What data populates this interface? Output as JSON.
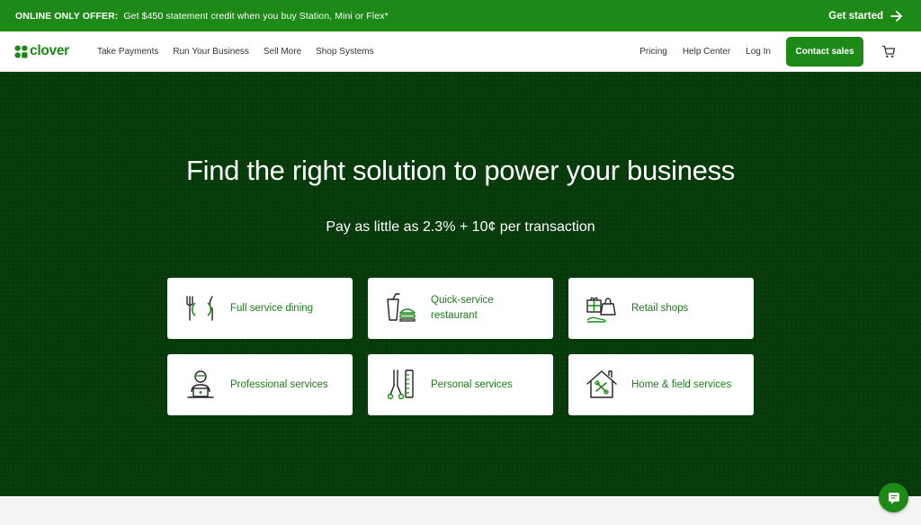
{
  "promo": {
    "label": "ONLINE ONLY OFFER:",
    "text": "Get $450 statement credit when you buy Station, Mini or Flex*",
    "cta": "Get started",
    "cta_icon": "arrow-right-icon"
  },
  "nav": {
    "logo_text": "clover",
    "left_links": [
      "Take Payments",
      "Run Your Business",
      "Sell More",
      "Shop Systems"
    ],
    "right_links": [
      "Pricing",
      "Help Center",
      "Log In"
    ],
    "contact_button": "Contact sales",
    "cart_icon": "cart-icon"
  },
  "hero": {
    "title": "Find the right solution to power your business",
    "subtitle": "Pay as little as 2.3% + 10¢ per transaction",
    "cards": [
      {
        "label": "Full service dining",
        "icon": "dining-icon"
      },
      {
        "label": "Quick-service restaurant",
        "icon": "quick-service-icon"
      },
      {
        "label": "Retail shops",
        "icon": "retail-icon"
      },
      {
        "label": "Professional services",
        "icon": "professional-icon"
      },
      {
        "label": "Personal services",
        "icon": "personal-services-icon"
      },
      {
        "label": "Home & field services",
        "icon": "home-field-icon"
      }
    ]
  },
  "chat": {
    "icon": "chat-icon"
  },
  "colors": {
    "brand_green": "#1d8a17",
    "hero_bg": "#073a0a",
    "card_text": "#1d7a19"
  }
}
